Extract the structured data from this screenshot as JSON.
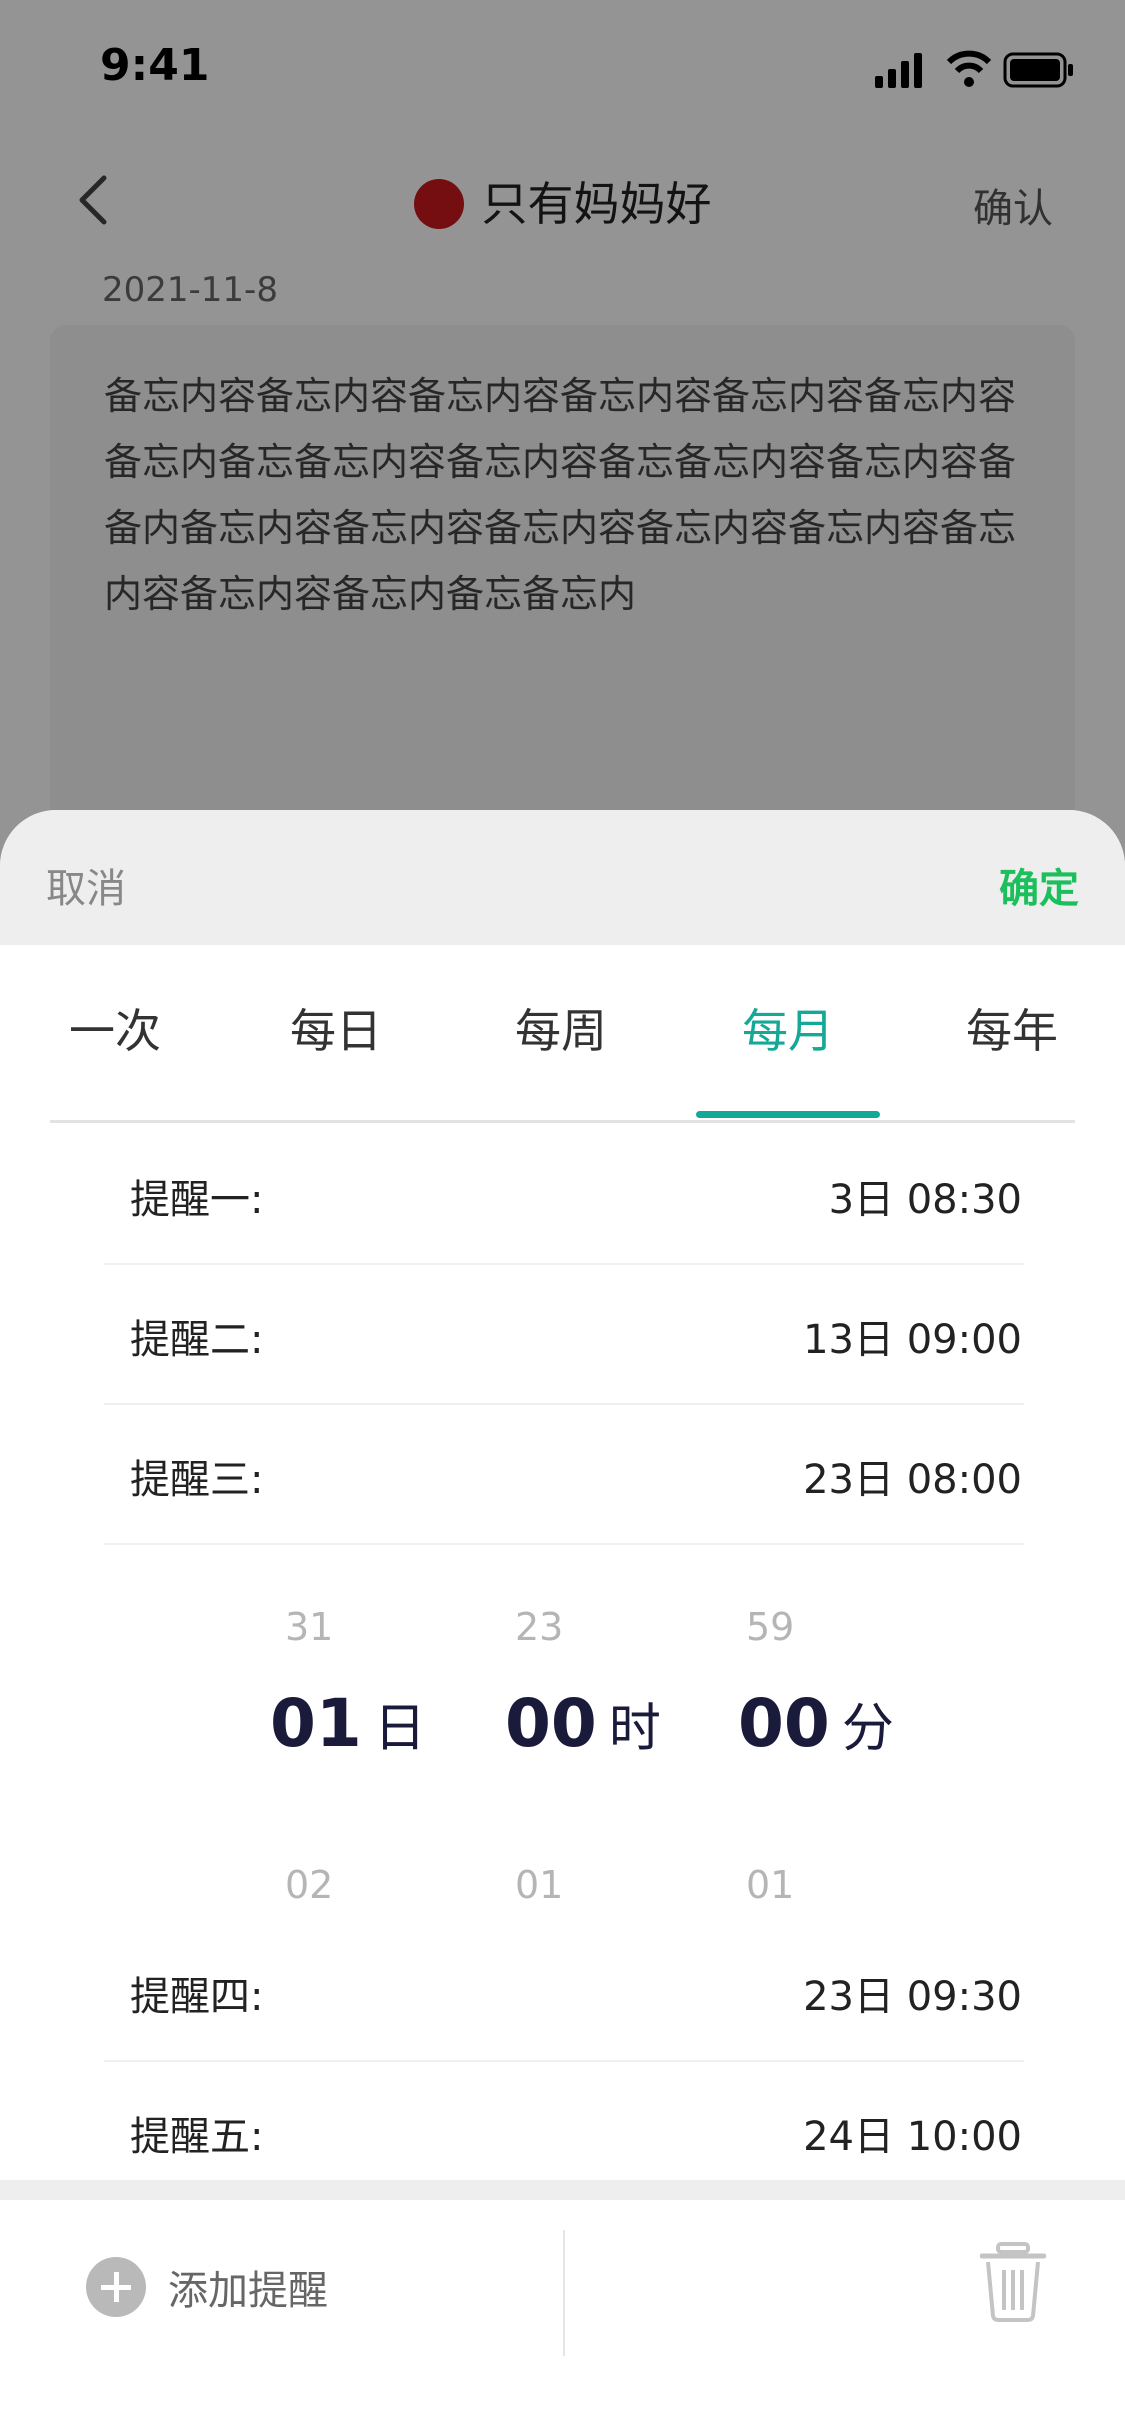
{
  "status_bar": {
    "time": "9:41"
  },
  "nav": {
    "title": "只有妈妈好",
    "confirm_label": "确认",
    "dot_color": "#c8191d"
  },
  "memo": {
    "date": "2021-11-8",
    "content": "备忘内容备忘内容备忘内容备忘内容备忘内容备忘内容备忘内备忘备忘内容备忘内容备忘备忘内容备忘内容备备内备忘内容备忘内容备忘内容备忘内容备忘内容备忘内容备忘内容备忘内备忘备忘内"
  },
  "sheet": {
    "cancel_label": "取消",
    "ok_label": "确定",
    "accent_color": "#14a896",
    "ok_color": "#1bbf5c",
    "tabs": [
      {
        "label": "一次"
      },
      {
        "label": "每日"
      },
      {
        "label": "每周"
      },
      {
        "label": "每月",
        "active": true
      },
      {
        "label": "每年"
      }
    ],
    "reminders": [
      {
        "label": "提醒一:",
        "value": "3日  08:30"
      },
      {
        "label": "提醒二:",
        "value": "13日  09:00"
      },
      {
        "label": "提醒三:",
        "value": "23日  08:00"
      },
      {
        "label": "提醒四:",
        "value": "23日  09:30"
      },
      {
        "label": "提醒五:",
        "value": "24日  10:00"
      }
    ],
    "picker": {
      "day": {
        "prev": "31",
        "value": "01",
        "unit": "日",
        "next": "02"
      },
      "hour": {
        "prev": "23",
        "value": "00",
        "unit": "时",
        "next": "01"
      },
      "minute": {
        "prev": "59",
        "value": "00",
        "unit": "分",
        "next": "01"
      }
    },
    "footer": {
      "add_label": "添加提醒"
    }
  }
}
